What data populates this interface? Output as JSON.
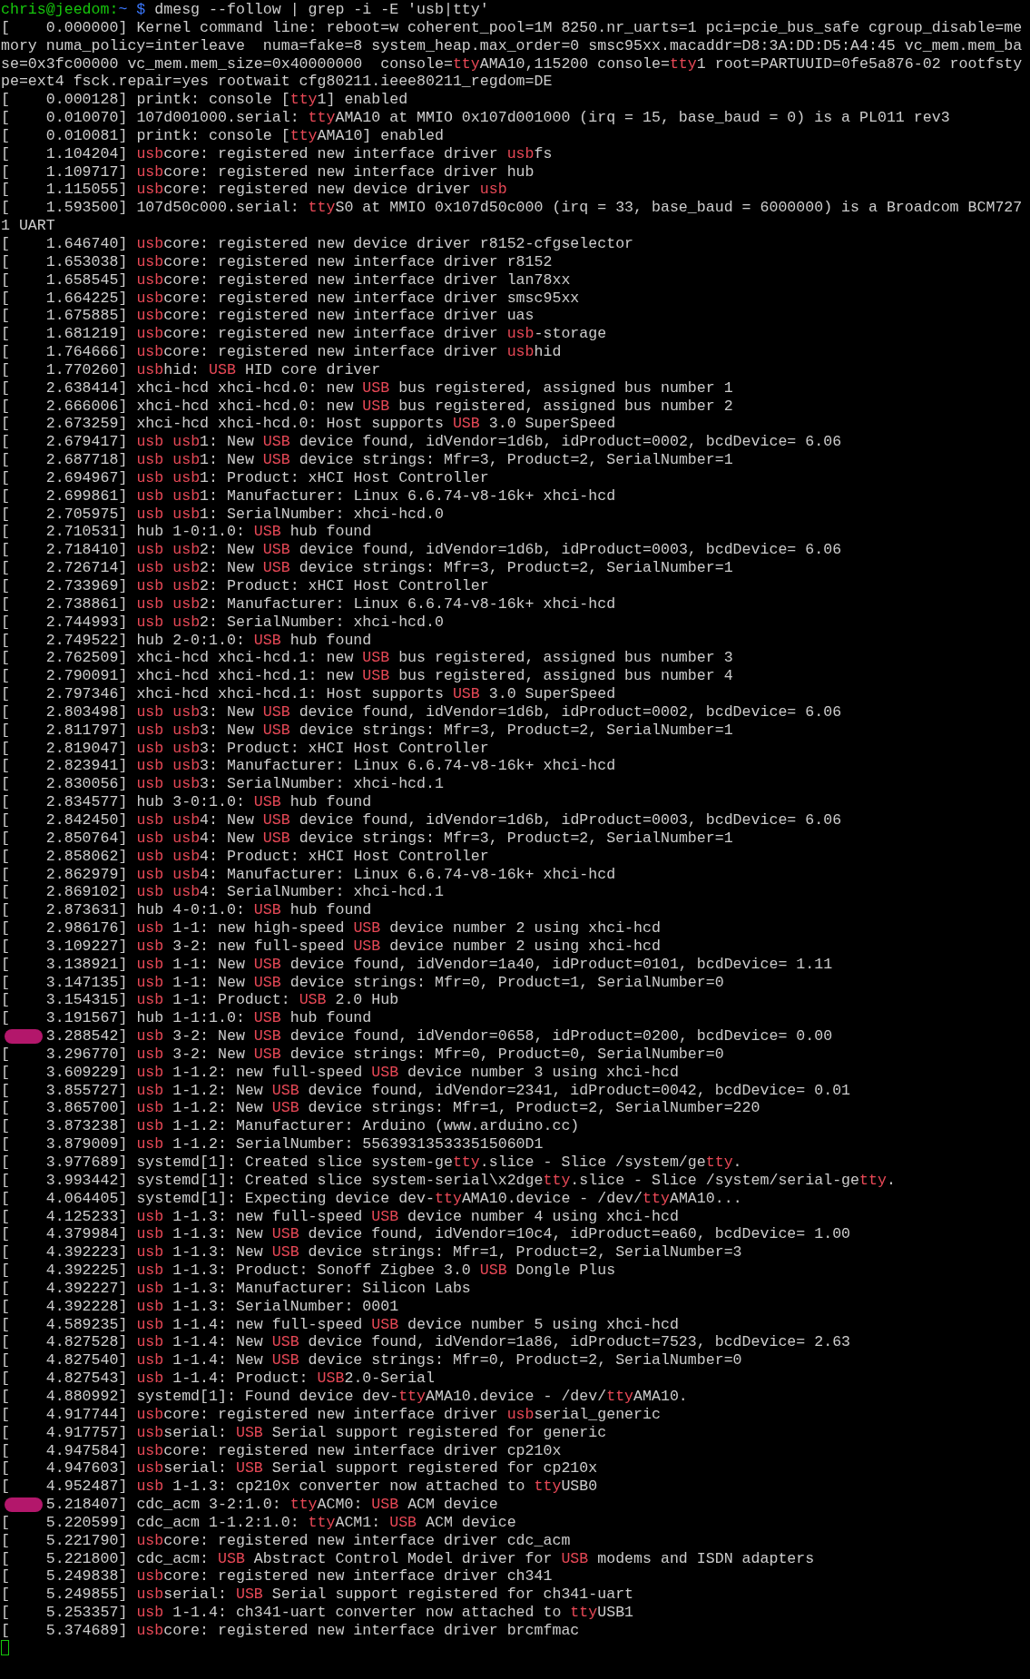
{
  "terminal": {
    "prompt": {
      "user_host": "chris@jeedom:",
      "path": "~ $",
      "command": " dmesg --follow | grep -i -E 'usb|tty'"
    },
    "lines": [
      {
        "ts": "[    0.000000] ",
        "highlighted": false,
        "parts": [
          {
            "text": "Kernel command line: reboot=w coherent_pool=1M 8250.nr_uarts=1 pci=pcie_bus_safe cgroup_disable=memory numa_policy=interleave  numa=fake=8 system_heap.max_order=0 smsc95xx.macaddr=D8:3A:DD:D5:A4:45 vc_mem.mem_base=0x3fc00000 vc_mem.mem_size=0x40000000  console=",
            "match": false
          },
          {
            "text": "tty",
            "match": true
          },
          {
            "text": "AMA10,115200 console=",
            "match": false
          },
          {
            "text": "tty",
            "match": true
          },
          {
            "text": "1 root=PARTUUID=0fe5a876-02 rootfstype=ext4 fsck.repair=yes rootwait cfg80211.ieee80211_regdom=DE",
            "match": false
          }
        ]
      },
      {
        "ts": "[    0.000128] ",
        "highlighted": false,
        "parts": [
          {
            "text": "printk: console [",
            "match": false
          },
          {
            "text": "tty",
            "match": true
          },
          {
            "text": "1] enabled",
            "match": false
          }
        ]
      },
      {
        "ts": "[    0.010070] ",
        "highlighted": false,
        "parts": [
          {
            "text": "107d001000.serial: ",
            "match": false
          },
          {
            "text": "tty",
            "match": true
          },
          {
            "text": "AMA10 at MMIO 0x107d001000 (irq = 15, base_baud = 0) is a PL011 rev3",
            "match": false
          }
        ]
      },
      {
        "ts": "[    0.010081] ",
        "highlighted": false,
        "parts": [
          {
            "text": "printk: console [",
            "match": false
          },
          {
            "text": "tty",
            "match": true
          },
          {
            "text": "AMA10] enabled",
            "match": false
          }
        ]
      },
      {
        "ts": "[    1.104204] ",
        "highlighted": false,
        "parts": [
          {
            "text": "usb",
            "match": true
          },
          {
            "text": "core: registered new interface driver ",
            "match": false
          },
          {
            "text": "usb",
            "match": true
          },
          {
            "text": "fs",
            "match": false
          }
        ]
      },
      {
        "ts": "[    1.109717] ",
        "highlighted": false,
        "parts": [
          {
            "text": "usb",
            "match": true
          },
          {
            "text": "core: registered new interface driver hub",
            "match": false
          }
        ]
      },
      {
        "ts": "[    1.115055] ",
        "highlighted": false,
        "parts": [
          {
            "text": "usb",
            "match": true
          },
          {
            "text": "core: registered new device driver ",
            "match": false
          },
          {
            "text": "usb",
            "match": true
          }
        ]
      },
      {
        "ts": "[    1.593500] ",
        "highlighted": false,
        "parts": [
          {
            "text": "107d50c000.serial: ",
            "match": false
          },
          {
            "text": "tty",
            "match": true
          },
          {
            "text": "S0 at MMIO 0x107d50c000 (irq = 33, base_baud = 6000000) is a Broadcom BCM7271 UART",
            "match": false
          }
        ]
      },
      {
        "ts": "[    1.646740] ",
        "highlighted": false,
        "parts": [
          {
            "text": "usb",
            "match": true
          },
          {
            "text": "core: registered new device driver r8152-cfgselector",
            "match": false
          }
        ]
      },
      {
        "ts": "[    1.653038] ",
        "highlighted": false,
        "parts": [
          {
            "text": "usb",
            "match": true
          },
          {
            "text": "core: registered new interface driver r8152",
            "match": false
          }
        ]
      },
      {
        "ts": "[    1.658545] ",
        "highlighted": false,
        "parts": [
          {
            "text": "usb",
            "match": true
          },
          {
            "text": "core: registered new interface driver lan78xx",
            "match": false
          }
        ]
      },
      {
        "ts": "[    1.664225] ",
        "highlighted": false,
        "parts": [
          {
            "text": "usb",
            "match": true
          },
          {
            "text": "core: registered new interface driver smsc95xx",
            "match": false
          }
        ]
      },
      {
        "ts": "[    1.675885] ",
        "highlighted": false,
        "parts": [
          {
            "text": "usb",
            "match": true
          },
          {
            "text": "core: registered new interface driver uas",
            "match": false
          }
        ]
      },
      {
        "ts": "[    1.681219] ",
        "highlighted": false,
        "parts": [
          {
            "text": "usb",
            "match": true
          },
          {
            "text": "core: registered new interface driver ",
            "match": false
          },
          {
            "text": "usb",
            "match": true
          },
          {
            "text": "-storage",
            "match": false
          }
        ]
      },
      {
        "ts": "[    1.764666] ",
        "highlighted": false,
        "parts": [
          {
            "text": "usb",
            "match": true
          },
          {
            "text": "core: registered new interface driver ",
            "match": false
          },
          {
            "text": "usb",
            "match": true
          },
          {
            "text": "hid",
            "match": false
          }
        ]
      },
      {
        "ts": "[    1.770260] ",
        "highlighted": false,
        "parts": [
          {
            "text": "usb",
            "match": true
          },
          {
            "text": "hid: ",
            "match": false
          },
          {
            "text": "USB",
            "match": true
          },
          {
            "text": " HID core driver",
            "match": false
          }
        ]
      },
      {
        "ts": "[    2.638414] ",
        "highlighted": false,
        "parts": [
          {
            "text": "xhci-hcd xhci-hcd.0: new ",
            "match": false
          },
          {
            "text": "USB",
            "match": true
          },
          {
            "text": " bus registered, assigned bus number 1",
            "match": false
          }
        ]
      },
      {
        "ts": "[    2.666006] ",
        "highlighted": false,
        "parts": [
          {
            "text": "xhci-hcd xhci-hcd.0: new ",
            "match": false
          },
          {
            "text": "USB",
            "match": true
          },
          {
            "text": " bus registered, assigned bus number 2",
            "match": false
          }
        ]
      },
      {
        "ts": "[    2.673259] ",
        "highlighted": false,
        "parts": [
          {
            "text": "xhci-hcd xhci-hcd.0: Host supports ",
            "match": false
          },
          {
            "text": "USB",
            "match": true
          },
          {
            "text": " 3.0 SuperSpeed",
            "match": false
          }
        ]
      },
      {
        "ts": "[    2.679417] ",
        "highlighted": false,
        "parts": [
          {
            "text": "usb ",
            "match": true
          },
          {
            "text": "usb",
            "match": true
          },
          {
            "text": "1: New ",
            "match": false
          },
          {
            "text": "USB",
            "match": true
          },
          {
            "text": " device found, idVendor=1d6b, idProduct=0002, bcdDevice= 6.06",
            "match": false
          }
        ]
      },
      {
        "ts": "[    2.687718] ",
        "highlighted": false,
        "parts": [
          {
            "text": "usb ",
            "match": true
          },
          {
            "text": "usb",
            "match": true
          },
          {
            "text": "1: New ",
            "match": false
          },
          {
            "text": "USB",
            "match": true
          },
          {
            "text": " device strings: Mfr=3, Product=2, SerialNumber=1",
            "match": false
          }
        ]
      },
      {
        "ts": "[    2.694967] ",
        "highlighted": false,
        "parts": [
          {
            "text": "usb ",
            "match": true
          },
          {
            "text": "usb",
            "match": true
          },
          {
            "text": "1: Product: xHCI Host Controller",
            "match": false
          }
        ]
      },
      {
        "ts": "[    2.699861] ",
        "highlighted": false,
        "parts": [
          {
            "text": "usb ",
            "match": true
          },
          {
            "text": "usb",
            "match": true
          },
          {
            "text": "1: Manufacturer: Linux 6.6.74-v8-16k+ xhci-hcd",
            "match": false
          }
        ]
      },
      {
        "ts": "[    2.705975] ",
        "highlighted": false,
        "parts": [
          {
            "text": "usb ",
            "match": true
          },
          {
            "text": "usb",
            "match": true
          },
          {
            "text": "1: SerialNumber: xhci-hcd.0",
            "match": false
          }
        ]
      },
      {
        "ts": "[    2.710531] ",
        "highlighted": false,
        "parts": [
          {
            "text": "hub 1-0:1.0: ",
            "match": false
          },
          {
            "text": "USB",
            "match": true
          },
          {
            "text": " hub found",
            "match": false
          }
        ]
      },
      {
        "ts": "[    2.718410] ",
        "highlighted": false,
        "parts": [
          {
            "text": "usb ",
            "match": true
          },
          {
            "text": "usb",
            "match": true
          },
          {
            "text": "2: New ",
            "match": false
          },
          {
            "text": "USB",
            "match": true
          },
          {
            "text": " device found, idVendor=1d6b, idProduct=0003, bcdDevice= 6.06",
            "match": false
          }
        ]
      },
      {
        "ts": "[    2.726714] ",
        "highlighted": false,
        "parts": [
          {
            "text": "usb ",
            "match": true
          },
          {
            "text": "usb",
            "match": true
          },
          {
            "text": "2: New ",
            "match": false
          },
          {
            "text": "USB",
            "match": true
          },
          {
            "text": " device strings: Mfr=3, Product=2, SerialNumber=1",
            "match": false
          }
        ]
      },
      {
        "ts": "[    2.733969] ",
        "highlighted": false,
        "parts": [
          {
            "text": "usb ",
            "match": true
          },
          {
            "text": "usb",
            "match": true
          },
          {
            "text": "2: Product: xHCI Host Controller",
            "match": false
          }
        ]
      },
      {
        "ts": "[    2.738861] ",
        "highlighted": false,
        "parts": [
          {
            "text": "usb ",
            "match": true
          },
          {
            "text": "usb",
            "match": true
          },
          {
            "text": "2: Manufacturer: Linux 6.6.74-v8-16k+ xhci-hcd",
            "match": false
          }
        ]
      },
      {
        "ts": "[    2.744993] ",
        "highlighted": false,
        "parts": [
          {
            "text": "usb ",
            "match": true
          },
          {
            "text": "usb",
            "match": true
          },
          {
            "text": "2: SerialNumber: xhci-hcd.0",
            "match": false
          }
        ]
      },
      {
        "ts": "[    2.749522] ",
        "highlighted": false,
        "parts": [
          {
            "text": "hub 2-0:1.0: ",
            "match": false
          },
          {
            "text": "USB",
            "match": true
          },
          {
            "text": " hub found",
            "match": false
          }
        ]
      },
      {
        "ts": "[    2.762509] ",
        "highlighted": false,
        "parts": [
          {
            "text": "xhci-hcd xhci-hcd.1: new ",
            "match": false
          },
          {
            "text": "USB",
            "match": true
          },
          {
            "text": " bus registered, assigned bus number 3",
            "match": false
          }
        ]
      },
      {
        "ts": "[    2.790091] ",
        "highlighted": false,
        "parts": [
          {
            "text": "xhci-hcd xhci-hcd.1: new ",
            "match": false
          },
          {
            "text": "USB",
            "match": true
          },
          {
            "text": " bus registered, assigned bus number 4",
            "match": false
          }
        ]
      },
      {
        "ts": "[    2.797346] ",
        "highlighted": false,
        "parts": [
          {
            "text": "xhci-hcd xhci-hcd.1: Host supports ",
            "match": false
          },
          {
            "text": "USB",
            "match": true
          },
          {
            "text": " 3.0 SuperSpeed",
            "match": false
          }
        ]
      },
      {
        "ts": "[    2.803498] ",
        "highlighted": false,
        "parts": [
          {
            "text": "usb ",
            "match": true
          },
          {
            "text": "usb",
            "match": true
          },
          {
            "text": "3: New ",
            "match": false
          },
          {
            "text": "USB",
            "match": true
          },
          {
            "text": " device found, idVendor=1d6b, idProduct=0002, bcdDevice= 6.06",
            "match": false
          }
        ]
      },
      {
        "ts": "[    2.811797] ",
        "highlighted": false,
        "parts": [
          {
            "text": "usb ",
            "match": true
          },
          {
            "text": "usb",
            "match": true
          },
          {
            "text": "3: New ",
            "match": false
          },
          {
            "text": "USB",
            "match": true
          },
          {
            "text": " device strings: Mfr=3, Product=2, SerialNumber=1",
            "match": false
          }
        ]
      },
      {
        "ts": "[    2.819047] ",
        "highlighted": false,
        "parts": [
          {
            "text": "usb ",
            "match": true
          },
          {
            "text": "usb",
            "match": true
          },
          {
            "text": "3: Product: xHCI Host Controller",
            "match": false
          }
        ]
      },
      {
        "ts": "[    2.823941] ",
        "highlighted": false,
        "parts": [
          {
            "text": "usb ",
            "match": true
          },
          {
            "text": "usb",
            "match": true
          },
          {
            "text": "3: Manufacturer: Linux 6.6.74-v8-16k+ xhci-hcd",
            "match": false
          }
        ]
      },
      {
        "ts": "[    2.830056] ",
        "highlighted": false,
        "parts": [
          {
            "text": "usb ",
            "match": true
          },
          {
            "text": "usb",
            "match": true
          },
          {
            "text": "3: SerialNumber: xhci-hcd.1",
            "match": false
          }
        ]
      },
      {
        "ts": "[    2.834577] ",
        "highlighted": false,
        "parts": [
          {
            "text": "hub 3-0:1.0: ",
            "match": false
          },
          {
            "text": "USB",
            "match": true
          },
          {
            "text": " hub found",
            "match": false
          }
        ]
      },
      {
        "ts": "[    2.842450] ",
        "highlighted": false,
        "parts": [
          {
            "text": "usb ",
            "match": true
          },
          {
            "text": "usb",
            "match": true
          },
          {
            "text": "4: New ",
            "match": false
          },
          {
            "text": "USB",
            "match": true
          },
          {
            "text": " device found, idVendor=1d6b, idProduct=0003, bcdDevice= 6.06",
            "match": false
          }
        ]
      },
      {
        "ts": "[    2.850764] ",
        "highlighted": false,
        "parts": [
          {
            "text": "usb ",
            "match": true
          },
          {
            "text": "usb",
            "match": true
          },
          {
            "text": "4: New ",
            "match": false
          },
          {
            "text": "USB",
            "match": true
          },
          {
            "text": " device strings: Mfr=3, Product=2, SerialNumber=1",
            "match": false
          }
        ]
      },
      {
        "ts": "[    2.858062] ",
        "highlighted": false,
        "parts": [
          {
            "text": "usb ",
            "match": true
          },
          {
            "text": "usb",
            "match": true
          },
          {
            "text": "4: Product: xHCI Host Controller",
            "match": false
          }
        ]
      },
      {
        "ts": "[    2.862979] ",
        "highlighted": false,
        "parts": [
          {
            "text": "usb ",
            "match": true
          },
          {
            "text": "usb",
            "match": true
          },
          {
            "text": "4: Manufacturer: Linux 6.6.74-v8-16k+ xhci-hcd",
            "match": false
          }
        ]
      },
      {
        "ts": "[    2.869102] ",
        "highlighted": false,
        "parts": [
          {
            "text": "usb ",
            "match": true
          },
          {
            "text": "usb",
            "match": true
          },
          {
            "text": "4: SerialNumber: xhci-hcd.1",
            "match": false
          }
        ]
      },
      {
        "ts": "[    2.873631] ",
        "highlighted": false,
        "parts": [
          {
            "text": "hub 4-0:1.0: ",
            "match": false
          },
          {
            "text": "USB",
            "match": true
          },
          {
            "text": " hub found",
            "match": false
          }
        ]
      },
      {
        "ts": "[    2.986176] ",
        "highlighted": false,
        "parts": [
          {
            "text": "usb",
            "match": true
          },
          {
            "text": " 1-1: new high-speed ",
            "match": false
          },
          {
            "text": "USB",
            "match": true
          },
          {
            "text": " device number 2 using xhci-hcd",
            "match": false
          }
        ]
      },
      {
        "ts": "[    3.109227] ",
        "highlighted": false,
        "parts": [
          {
            "text": "usb",
            "match": true
          },
          {
            "text": " 3-2: new full-speed ",
            "match": false
          },
          {
            "text": "USB",
            "match": true
          },
          {
            "text": " device number 2 using xhci-hcd",
            "match": false
          }
        ]
      },
      {
        "ts": "[    3.138921] ",
        "highlighted": false,
        "parts": [
          {
            "text": "usb",
            "match": true
          },
          {
            "text": " 1-1: New ",
            "match": false
          },
          {
            "text": "USB",
            "match": true
          },
          {
            "text": " device found, idVendor=1a40, idProduct=0101, bcdDevice= 1.11",
            "match": false
          }
        ]
      },
      {
        "ts": "[    3.147135] ",
        "highlighted": false,
        "parts": [
          {
            "text": "usb",
            "match": true
          },
          {
            "text": " 1-1: New ",
            "match": false
          },
          {
            "text": "USB",
            "match": true
          },
          {
            "text": " device strings: Mfr=0, Product=1, SerialNumber=0",
            "match": false
          }
        ]
      },
      {
        "ts": "[    3.154315] ",
        "highlighted": false,
        "parts": [
          {
            "text": "usb",
            "match": true
          },
          {
            "text": " 1-1: Product: ",
            "match": false
          },
          {
            "text": "USB",
            "match": true
          },
          {
            "text": " 2.0 Hub",
            "match": false
          }
        ]
      },
      {
        "ts": "[    3.191567] ",
        "highlighted": false,
        "parts": [
          {
            "text": "hub 1-1:1.0: ",
            "match": false
          },
          {
            "text": "USB",
            "match": true
          },
          {
            "text": " hub found",
            "match": false
          }
        ]
      },
      {
        "ts": "     3.288542] ",
        "highlighted": true,
        "parts": [
          {
            "text": "usb",
            "match": true
          },
          {
            "text": " 3-2: New ",
            "match": false
          },
          {
            "text": "USB",
            "match": true
          },
          {
            "text": " device found, idVendor=0658, idProduct=0200, bcdDevice= 0.00",
            "match": false
          }
        ]
      },
      {
        "ts": "[    3.296770] ",
        "highlighted": false,
        "parts": [
          {
            "text": "usb",
            "match": true
          },
          {
            "text": " 3-2: New ",
            "match": false
          },
          {
            "text": "USB",
            "match": true
          },
          {
            "text": " device strings: Mfr=0, Product=0, SerialNumber=0",
            "match": false
          }
        ]
      },
      {
        "ts": "[    3.609229] ",
        "highlighted": false,
        "parts": [
          {
            "text": "usb",
            "match": true
          },
          {
            "text": " 1-1.2: new full-speed ",
            "match": false
          },
          {
            "text": "USB",
            "match": true
          },
          {
            "text": " device number 3 using xhci-hcd",
            "match": false
          }
        ]
      },
      {
        "ts": "[    3.855727] ",
        "highlighted": false,
        "parts": [
          {
            "text": "usb",
            "match": true
          },
          {
            "text": " 1-1.2: New ",
            "match": false
          },
          {
            "text": "USB",
            "match": true
          },
          {
            "text": " device found, idVendor=2341, idProduct=0042, bcdDevice= 0.01",
            "match": false
          }
        ]
      },
      {
        "ts": "[    3.865700] ",
        "highlighted": false,
        "parts": [
          {
            "text": "usb",
            "match": true
          },
          {
            "text": " 1-1.2: New ",
            "match": false
          },
          {
            "text": "USB",
            "match": true
          },
          {
            "text": " device strings: Mfr=1, Product=2, SerialNumber=220",
            "match": false
          }
        ]
      },
      {
        "ts": "[    3.873238] ",
        "highlighted": false,
        "parts": [
          {
            "text": "usb",
            "match": true
          },
          {
            "text": " 1-1.2: Manufacturer: Arduino (www.arduino.cc)",
            "match": false
          }
        ]
      },
      {
        "ts": "[    3.879009] ",
        "highlighted": false,
        "parts": [
          {
            "text": "usb",
            "match": true
          },
          {
            "text": " 1-1.2: SerialNumber: 556393135333515060D1",
            "match": false
          }
        ]
      },
      {
        "ts": "[    3.977689] ",
        "highlighted": false,
        "parts": [
          {
            "text": "systemd[1]: Created slice system-ge",
            "match": false
          },
          {
            "text": "tty",
            "match": true
          },
          {
            "text": ".slice - Slice /system/ge",
            "match": false
          },
          {
            "text": "tty",
            "match": true
          },
          {
            "text": ".",
            "match": false
          }
        ]
      },
      {
        "ts": "[    3.993442] ",
        "highlighted": false,
        "parts": [
          {
            "text": "systemd[1]: Created slice system-serial\\x2dge",
            "match": false
          },
          {
            "text": "tty",
            "match": true
          },
          {
            "text": ".slice - Slice /system/serial-ge",
            "match": false
          },
          {
            "text": "tty",
            "match": true
          },
          {
            "text": ".",
            "match": false
          }
        ]
      },
      {
        "ts": "[    4.064405] ",
        "highlighted": false,
        "parts": [
          {
            "text": "systemd[1]: Expecting device dev-",
            "match": false
          },
          {
            "text": "tty",
            "match": true
          },
          {
            "text": "AMA10.device - /dev/",
            "match": false
          },
          {
            "text": "tty",
            "match": true
          },
          {
            "text": "AMA10...",
            "match": false
          }
        ]
      },
      {
        "ts": "[    4.125233] ",
        "highlighted": false,
        "parts": [
          {
            "text": "usb",
            "match": true
          },
          {
            "text": " 1-1.3: new full-speed ",
            "match": false
          },
          {
            "text": "USB",
            "match": true
          },
          {
            "text": " device number 4 using xhci-hcd",
            "match": false
          }
        ]
      },
      {
        "ts": "[    4.379984] ",
        "highlighted": false,
        "parts": [
          {
            "text": "usb",
            "match": true
          },
          {
            "text": " 1-1.3: New ",
            "match": false
          },
          {
            "text": "USB",
            "match": true
          },
          {
            "text": " device found, idVendor=10c4, idProduct=ea60, bcdDevice= 1.00",
            "match": false
          }
        ]
      },
      {
        "ts": "[    4.392223] ",
        "highlighted": false,
        "parts": [
          {
            "text": "usb",
            "match": true
          },
          {
            "text": " 1-1.3: New ",
            "match": false
          },
          {
            "text": "USB",
            "match": true
          },
          {
            "text": " device strings: Mfr=1, Product=2, SerialNumber=3",
            "match": false
          }
        ]
      },
      {
        "ts": "[    4.392225] ",
        "highlighted": false,
        "parts": [
          {
            "text": "usb",
            "match": true
          },
          {
            "text": " 1-1.3: Product: Sonoff Zigbee 3.0 ",
            "match": false
          },
          {
            "text": "USB",
            "match": true
          },
          {
            "text": " Dongle Plus",
            "match": false
          }
        ]
      },
      {
        "ts": "[    4.392227] ",
        "highlighted": false,
        "parts": [
          {
            "text": "usb",
            "match": true
          },
          {
            "text": " 1-1.3: Manufacturer: Silicon Labs",
            "match": false
          }
        ]
      },
      {
        "ts": "[    4.392228] ",
        "highlighted": false,
        "parts": [
          {
            "text": "usb",
            "match": true
          },
          {
            "text": " 1-1.3: SerialNumber: 0001",
            "match": false
          }
        ]
      },
      {
        "ts": "[    4.589235] ",
        "highlighted": false,
        "parts": [
          {
            "text": "usb",
            "match": true
          },
          {
            "text": " 1-1.4: new full-speed ",
            "match": false
          },
          {
            "text": "USB",
            "match": true
          },
          {
            "text": " device number 5 using xhci-hcd",
            "match": false
          }
        ]
      },
      {
        "ts": "[    4.827528] ",
        "highlighted": false,
        "parts": [
          {
            "text": "usb",
            "match": true
          },
          {
            "text": " 1-1.4: New ",
            "match": false
          },
          {
            "text": "USB",
            "match": true
          },
          {
            "text": " device found, idVendor=1a86, idProduct=7523, bcdDevice= 2.63",
            "match": false
          }
        ]
      },
      {
        "ts": "[    4.827540] ",
        "highlighted": false,
        "parts": [
          {
            "text": "usb",
            "match": true
          },
          {
            "text": " 1-1.4: New ",
            "match": false
          },
          {
            "text": "USB",
            "match": true
          },
          {
            "text": " device strings: Mfr=0, Product=2, SerialNumber=0",
            "match": false
          }
        ]
      },
      {
        "ts": "[    4.827543] ",
        "highlighted": false,
        "parts": [
          {
            "text": "usb",
            "match": true
          },
          {
            "text": " 1-1.4: Product: ",
            "match": false
          },
          {
            "text": "USB",
            "match": true
          },
          {
            "text": "2.0-Serial",
            "match": false
          }
        ]
      },
      {
        "ts": "[    4.880992] ",
        "highlighted": false,
        "parts": [
          {
            "text": "systemd[1]: Found device dev-",
            "match": false
          },
          {
            "text": "tty",
            "match": true
          },
          {
            "text": "AMA10.device - /dev/",
            "match": false
          },
          {
            "text": "tty",
            "match": true
          },
          {
            "text": "AMA10.",
            "match": false
          }
        ]
      },
      {
        "ts": "[    4.917744] ",
        "highlighted": false,
        "parts": [
          {
            "text": "usb",
            "match": true
          },
          {
            "text": "core: registered new interface driver ",
            "match": false
          },
          {
            "text": "usb",
            "match": true
          },
          {
            "text": "serial_generic",
            "match": false
          }
        ]
      },
      {
        "ts": "[    4.917757] ",
        "highlighted": false,
        "parts": [
          {
            "text": "usb",
            "match": true
          },
          {
            "text": "serial: ",
            "match": false
          },
          {
            "text": "USB",
            "match": true
          },
          {
            "text": " Serial support registered for generic",
            "match": false
          }
        ]
      },
      {
        "ts": "[    4.947584] ",
        "highlighted": false,
        "parts": [
          {
            "text": "usb",
            "match": true
          },
          {
            "text": "core: registered new interface driver cp210x",
            "match": false
          }
        ]
      },
      {
        "ts": "[    4.947603] ",
        "highlighted": false,
        "parts": [
          {
            "text": "usb",
            "match": true
          },
          {
            "text": "serial: ",
            "match": false
          },
          {
            "text": "USB",
            "match": true
          },
          {
            "text": " Serial support registered for cp210x",
            "match": false
          }
        ]
      },
      {
        "ts": "[    4.952487] ",
        "highlighted": false,
        "parts": [
          {
            "text": "usb",
            "match": true
          },
          {
            "text": " 1-1.3: cp210x converter now attached to ",
            "match": false
          },
          {
            "text": "tty",
            "match": true
          },
          {
            "text": "USB0",
            "match": false
          }
        ]
      },
      {
        "ts": "     5.218407] ",
        "highlighted": true,
        "parts": [
          {
            "text": "cdc_acm 3-2:1.0: ",
            "match": false
          },
          {
            "text": "tty",
            "match": true
          },
          {
            "text": "ACM0: ",
            "match": false
          },
          {
            "text": "USB",
            "match": true
          },
          {
            "text": " ACM device",
            "match": false
          }
        ]
      },
      {
        "ts": "[    5.220599] ",
        "highlighted": false,
        "parts": [
          {
            "text": "cdc_acm 1-1.2:1.0: ",
            "match": false
          },
          {
            "text": "tty",
            "match": true
          },
          {
            "text": "ACM1: ",
            "match": false
          },
          {
            "text": "USB",
            "match": true
          },
          {
            "text": " ACM device",
            "match": false
          }
        ]
      },
      {
        "ts": "[    5.221790] ",
        "highlighted": false,
        "parts": [
          {
            "text": "usb",
            "match": true
          },
          {
            "text": "core: registered new interface driver cdc_acm",
            "match": false
          }
        ]
      },
      {
        "ts": "[    5.221800] ",
        "highlighted": false,
        "parts": [
          {
            "text": "cdc_acm: ",
            "match": false
          },
          {
            "text": "USB",
            "match": true
          },
          {
            "text": " Abstract Control Model driver for ",
            "match": false
          },
          {
            "text": "USB",
            "match": true
          },
          {
            "text": " modems and ISDN adapters",
            "match": false
          }
        ]
      },
      {
        "ts": "[    5.249838] ",
        "highlighted": false,
        "parts": [
          {
            "text": "usb",
            "match": true
          },
          {
            "text": "core: registered new interface driver ch341",
            "match": false
          }
        ]
      },
      {
        "ts": "[    5.249855] ",
        "highlighted": false,
        "parts": [
          {
            "text": "usb",
            "match": true
          },
          {
            "text": "serial: ",
            "match": false
          },
          {
            "text": "USB",
            "match": true
          },
          {
            "text": " Serial support registered for ch341-uart",
            "match": false
          }
        ]
      },
      {
        "ts": "[    5.253357] ",
        "highlighted": false,
        "parts": [
          {
            "text": "usb",
            "match": true
          },
          {
            "text": " 1-1.4: ch341-uart converter now attached to ",
            "match": false
          },
          {
            "text": "tty",
            "match": true
          },
          {
            "text": "USB1",
            "match": false
          }
        ]
      },
      {
        "ts": "[    5.374689] ",
        "highlighted": false,
        "parts": [
          {
            "text": "usb",
            "match": true
          },
          {
            "text": "core: registered new interface driver brcmfmac",
            "match": false
          }
        ]
      }
    ]
  }
}
